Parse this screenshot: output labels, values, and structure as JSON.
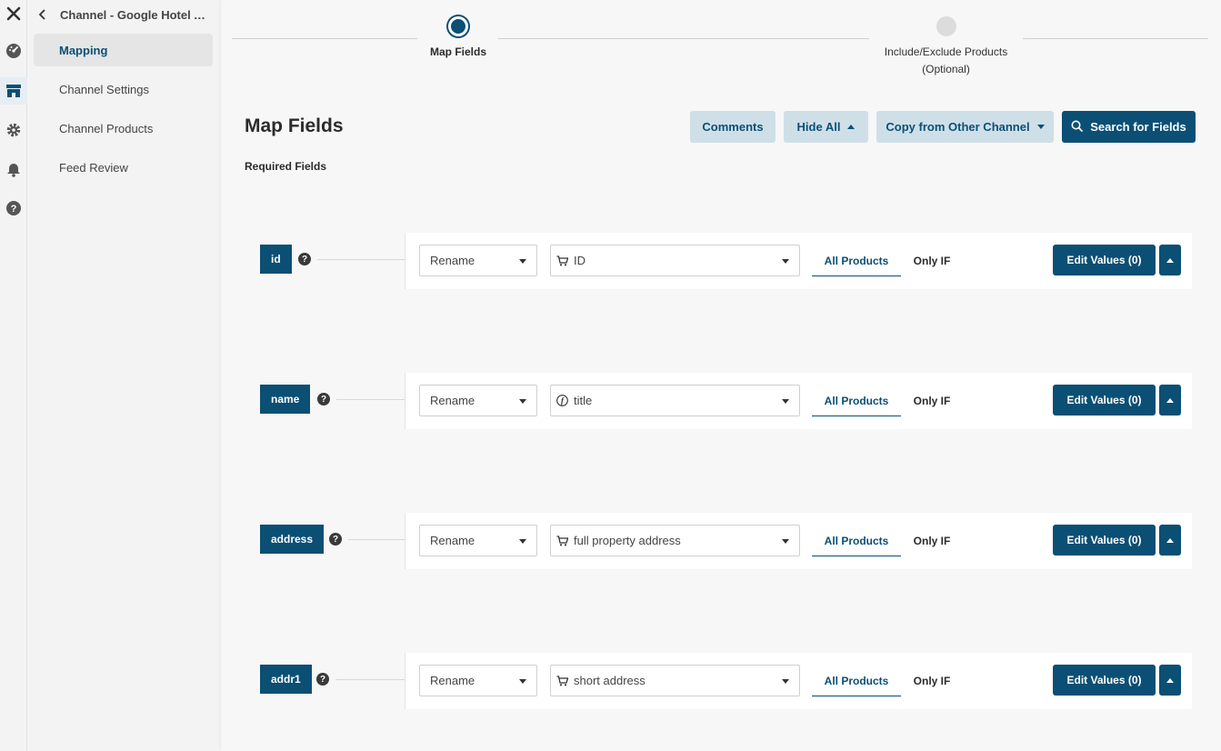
{
  "rail": {
    "icons": [
      "close-icon",
      "dashboard-icon",
      "store-icon",
      "gear-icon",
      "bell-icon",
      "help-icon"
    ]
  },
  "sidebar": {
    "title": "Channel - Google Hotel Ad...",
    "items": [
      {
        "label": "Mapping",
        "active": true
      },
      {
        "label": "Channel Settings",
        "active": false
      },
      {
        "label": "Channel Products",
        "active": false
      },
      {
        "label": "Feed Review",
        "active": false
      }
    ]
  },
  "stepper": {
    "steps": [
      {
        "label": "Map Fields",
        "sublabel": "",
        "active": true
      },
      {
        "label": "Include/Exclude Products",
        "sublabel": "(Optional)",
        "active": false
      }
    ]
  },
  "header": {
    "title": "Map Fields",
    "section": "Required Fields",
    "buttons": {
      "comments": "Comments",
      "hide_all": "Hide All",
      "copy": "Copy from Other Channel",
      "search": "Search for Fields"
    }
  },
  "rows": [
    {
      "field": "id",
      "action": "Rename",
      "source": "ID",
      "source_icon": "cart-icon",
      "tab_all": "All Products",
      "tab_if": "Only IF",
      "edit": "Edit Values (0)"
    },
    {
      "field": "name",
      "action": "Rename",
      "source": "title",
      "source_icon": "function-icon",
      "tab_all": "All Products",
      "tab_if": "Only IF",
      "edit": "Edit Values (0)"
    },
    {
      "field": "address",
      "action": "Rename",
      "source": "full property address",
      "source_icon": "cart-icon",
      "tab_all": "All Products",
      "tab_if": "Only IF",
      "edit": "Edit Values (0)"
    },
    {
      "field": "addr1",
      "action": "Rename",
      "source": "short address",
      "source_icon": "cart-icon",
      "tab_all": "All Products",
      "tab_if": "Only IF",
      "edit": "Edit Values (0)"
    }
  ],
  "colors": {
    "primary": "#0b4f74",
    "light_button": "#cfdfe8",
    "background": "#f7f7f7"
  }
}
